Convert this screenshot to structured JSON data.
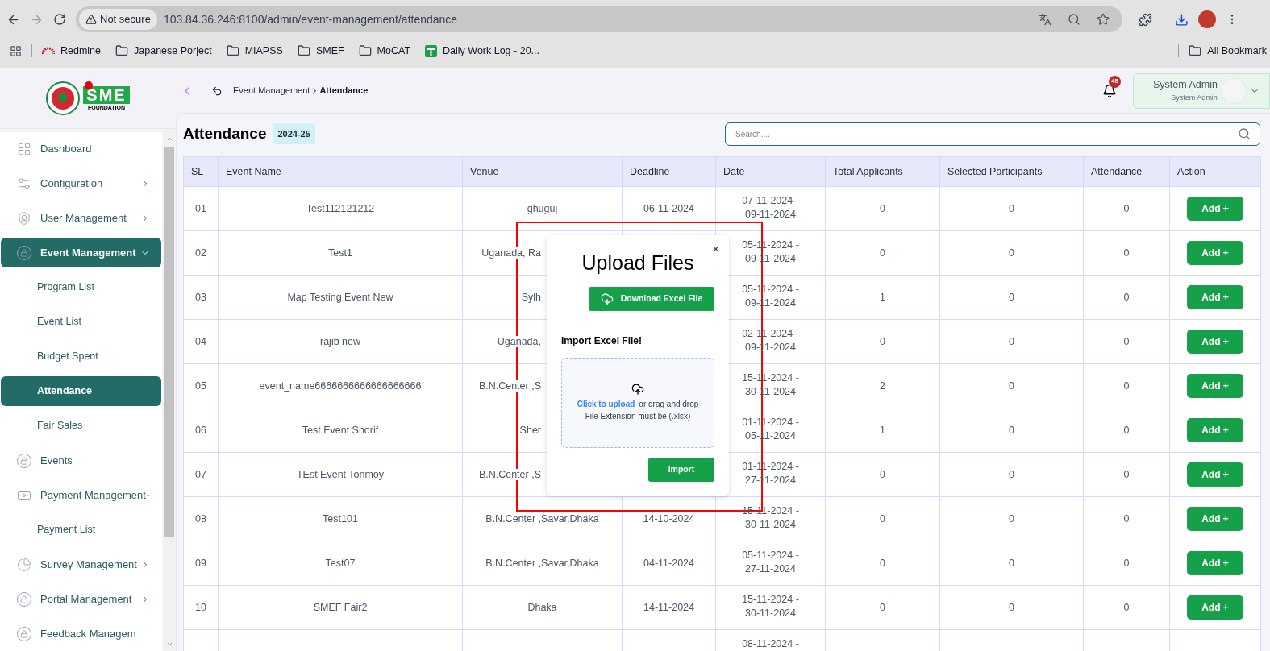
{
  "browser": {
    "security_label": "Not secure",
    "url": "103.84.36.246:8100/admin/event-management/attendance",
    "bookmarks": [
      {
        "kind": "redmine",
        "label": "Redmine"
      },
      {
        "kind": "folder",
        "label": "Japanese Porject"
      },
      {
        "kind": "folder",
        "label": "MIAPSS"
      },
      {
        "kind": "folder",
        "label": "SMEF"
      },
      {
        "kind": "folder",
        "label": "MoCAT"
      },
      {
        "kind": "sheet",
        "label": "Daily Work Log - 20..."
      }
    ],
    "all_bookmarks": "All Bookmark"
  },
  "logo": {
    "letters": "SME",
    "subtitle": "FOUNDATION"
  },
  "sidebar": {
    "items": [
      {
        "kind": "link",
        "label": "Dashboard",
        "selected": false
      },
      {
        "kind": "group",
        "label": "Configuration",
        "selected": false,
        "expanded": false
      },
      {
        "kind": "group",
        "label": "User Management",
        "selected": false,
        "expanded": false
      },
      {
        "kind": "group",
        "label": "Event Management",
        "selected": true,
        "expanded": true,
        "children": [
          {
            "label": "Program List",
            "selected": false
          },
          {
            "label": "Event List",
            "selected": false
          },
          {
            "label": "Budget Spent",
            "selected": false
          },
          {
            "label": "Attendance",
            "selected": true
          },
          {
            "label": "Fair Sales",
            "selected": false
          }
        ]
      },
      {
        "kind": "link",
        "label": "Events",
        "selected": false
      },
      {
        "kind": "group",
        "label": "Payment Management",
        "selected": false,
        "expanded": true,
        "children": [
          {
            "label": "Payment List",
            "selected": false
          }
        ]
      },
      {
        "kind": "group",
        "label": "Survey Management",
        "selected": false,
        "expanded": false
      },
      {
        "kind": "group",
        "label": "Portal Management",
        "selected": false,
        "expanded": false
      },
      {
        "kind": "link",
        "label": "Feedback Managem",
        "selected": false
      }
    ]
  },
  "header": {
    "breadcrumb": [
      "Event Management",
      "Attendance"
    ],
    "notifications": "45",
    "user": {
      "name": "System Admin",
      "role": "System Admin"
    }
  },
  "page": {
    "title": "Attendance",
    "badge": "2024-25",
    "search": {
      "placeholder": "Search...."
    }
  },
  "table": {
    "columns": [
      "SL",
      "Event Name",
      "Venue",
      "Deadline",
      "Date",
      "Total Applicants",
      "Selected Participants",
      "Attendance",
      "Action"
    ],
    "rows": [
      {
        "sl": "01",
        "event_name": "Test112121212",
        "venue": "ghuguj",
        "deadline": "06-11-2024",
        "date": [
          "07-11-2024 -",
          "09-11-2024"
        ],
        "total": "0",
        "selected": "0",
        "attendance": "0",
        "action": "Add +"
      },
      {
        "sl": "02",
        "event_name": "Test1",
        "venue": "Uganada, Ra",
        "deadline": "",
        "date": [
          "05-11-2024 -",
          "09-11-2024"
        ],
        "total": "0",
        "selected": "0",
        "attendance": "0",
        "action": "Add +"
      },
      {
        "sl": "03",
        "event_name": "Map Testing Event New",
        "venue": "Sylh",
        "deadline": "",
        "date": [
          "05-11-2024 -",
          "09-11-2024"
        ],
        "total": "1",
        "selected": "0",
        "attendance": "0",
        "action": "Add +"
      },
      {
        "sl": "04",
        "event_name": "rajib new",
        "venue": "Uganada,",
        "deadline": "",
        "date": [
          "02-11-2024 -",
          "09-11-2024"
        ],
        "total": "0",
        "selected": "0",
        "attendance": "0",
        "action": "Add +"
      },
      {
        "sl": "05",
        "event_name": "event_name6666666666666666666",
        "venue": "B.N.Center ,S",
        "deadline": "",
        "date": [
          "15-11-2024 -",
          "30-11-2024"
        ],
        "total": "2",
        "selected": "0",
        "attendance": "0",
        "action": "Add +"
      },
      {
        "sl": "06",
        "event_name": "Test Event Shorif",
        "venue": "Sher",
        "deadline": "",
        "date": [
          "01-11-2024 -",
          "05-11-2024"
        ],
        "total": "1",
        "selected": "0",
        "attendance": "0",
        "action": "Add +"
      },
      {
        "sl": "07",
        "event_name": "TEst Event Tonmoy",
        "venue": "B.N.Center ,S",
        "deadline": "",
        "date": [
          "01-11-2024 -",
          "27-11-2024"
        ],
        "total": "0",
        "selected": "0",
        "attendance": "0",
        "action": "Add +"
      },
      {
        "sl": "08",
        "event_name": "Test101",
        "venue": "B.N.Center ,Savar,Dhaka",
        "deadline": "14-10-2024",
        "date": [
          "15-11-2024 -",
          "30-11-2024"
        ],
        "total": "0",
        "selected": "0",
        "attendance": "0",
        "action": "Add +"
      },
      {
        "sl": "09",
        "event_name": "Test07",
        "venue": "B.N.Center ,Savar,Dhaka",
        "deadline": "04-11-2024",
        "date": [
          "05-11-2024 -",
          "27-11-2024"
        ],
        "total": "0",
        "selected": "0",
        "attendance": "0",
        "action": "Add +"
      },
      {
        "sl": "10",
        "event_name": "SMEF Fair2",
        "venue": "Dhaka",
        "deadline": "14-11-2024",
        "date": [
          "15-11-2024 -",
          "30-11-2024"
        ],
        "total": "0",
        "selected": "0",
        "attendance": "0",
        "action": "Add +"
      },
      {
        "sl": "",
        "event_name": "",
        "venue": "",
        "deadline": "",
        "date": [
          "08-11-2024 -"
        ],
        "total": "",
        "selected": "",
        "attendance": "",
        "action": ""
      }
    ]
  },
  "modal": {
    "title": "Upload Files",
    "download_button": "Download Excel File",
    "import_label": "Import Excel File!",
    "upload_link": "Click to upload",
    "upload_text": "or drag and drop",
    "extension_note": "File Extension must be (.xlsx)",
    "import_button": "Import",
    "close": "×"
  },
  "highlight_frame": true
}
